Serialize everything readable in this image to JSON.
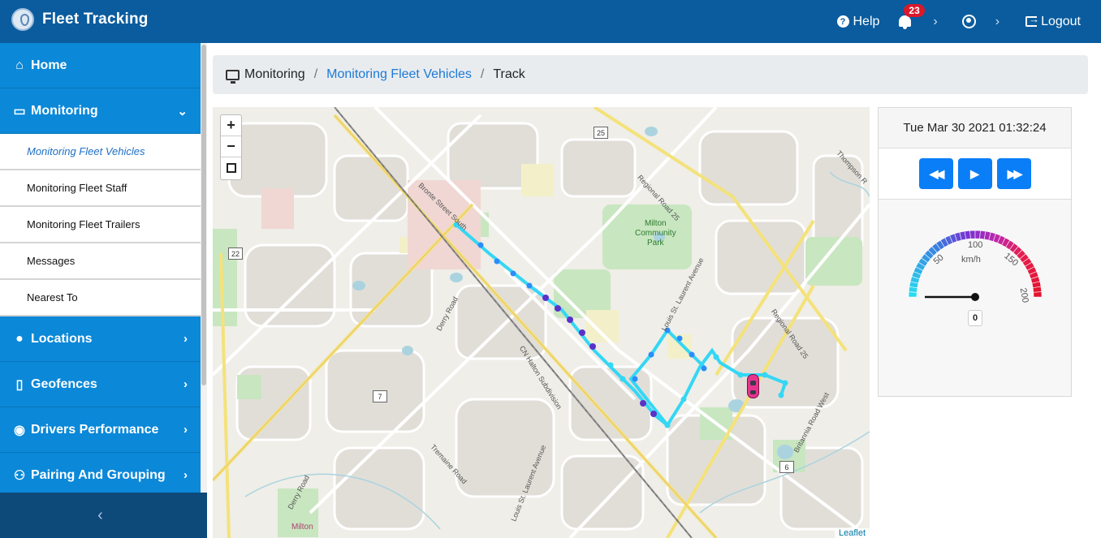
{
  "header": {
    "title": "Fleet Tracking",
    "help_label": "Help",
    "notifications_count": "23",
    "logout_label": "Logout"
  },
  "sidebar": {
    "items": [
      {
        "label": "Home",
        "icon": "home-icon"
      },
      {
        "label": "Monitoring",
        "icon": "monitor-icon",
        "expanded": true
      },
      {
        "label": "Locations",
        "icon": "location-pin-icon"
      },
      {
        "label": "Geofences",
        "icon": "map-icon"
      },
      {
        "label": "Drivers Performance",
        "icon": "driver-icon"
      },
      {
        "label": "Pairing And Grouping",
        "icon": "pairing-icon"
      }
    ],
    "submenu": [
      {
        "label": "Monitoring Fleet Vehicles",
        "active": true
      },
      {
        "label": "Monitoring Fleet Staff"
      },
      {
        "label": "Monitoring Fleet Trailers"
      },
      {
        "label": "Messages"
      },
      {
        "label": "Nearest To"
      }
    ]
  },
  "breadcrumb": {
    "items": [
      "Monitoring",
      "Monitoring Fleet Vehicles",
      "Track"
    ]
  },
  "map": {
    "zoom_in": "+",
    "zoom_out": "−",
    "attribution": "Leaflet",
    "labels": {
      "bronte": "Bronte Street South",
      "derry": "Derry Road",
      "derry2": "Derry Road",
      "regional25a": "Regional Road 25",
      "regional25b": "Regional Road 25",
      "louis": "Louis St. Laurent Avenue",
      "louis2": "Louis St. Laurent Avenue",
      "cn": "CN Halton Subdivision",
      "tremaine": "Tremaine Road",
      "britannia": "Britannia Road West",
      "thompson": "Thompson R",
      "milton": "Milton",
      "park": "Milton Community Park",
      "park_line1": "Milton",
      "park_line2": "Community",
      "park_line3": "Park"
    },
    "road_numbers": [
      "25",
      "22",
      "7",
      "6"
    ]
  },
  "playback": {
    "datetime": "Tue Mar 30 2021 01:32:24",
    "controls": [
      "rewind",
      "play",
      "fast-forward"
    ]
  },
  "speedometer": {
    "unit": "km/h",
    "value": "0",
    "ticks": [
      "50",
      "100",
      "150",
      "200"
    ],
    "max": 200
  }
}
